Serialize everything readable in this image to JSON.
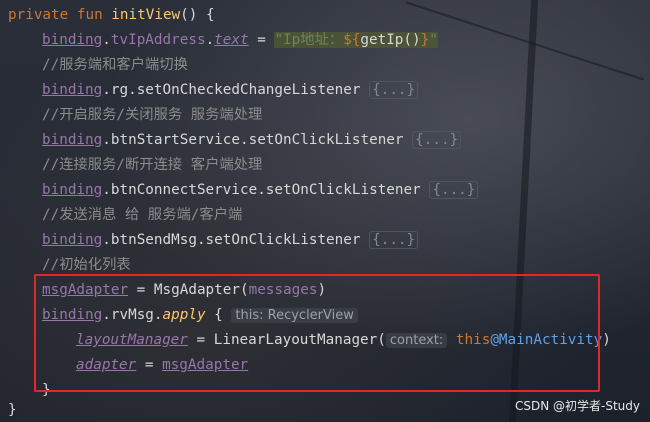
{
  "code": {
    "l1": {
      "kw": "private fun ",
      "fn": "initView",
      "rest": "() {"
    },
    "l2": {
      "recv": "binding",
      "dot1": ".",
      "p1": "tvIpAddress",
      "dot2": ".",
      "p2": "text",
      "eq": " = ",
      "s1": "\"Ip地址：",
      "tmpl": "${",
      "call": "getIp()",
      "tmplEnd": "}",
      "s2": "\""
    },
    "l3": {
      "comment": "//服务端和客户端切换"
    },
    "l4": {
      "recv": "binding",
      "mid": ".rg.setOnCheckedChangeListener ",
      "fold": "{...}"
    },
    "l5": {
      "comment": "//开启服务/关闭服务 服务端处理"
    },
    "l6": {
      "recv": "binding",
      "mid": ".btnStartService.setOnClickListener ",
      "fold": "{...}"
    },
    "l7": {
      "comment": "//连接服务/断开连接 客户端处理"
    },
    "l8": {
      "recv": "binding",
      "mid": ".btnConnectService.setOnClickListener ",
      "fold": "{...}"
    },
    "l9": {
      "comment": "//发送消息 给 服务端/客户端"
    },
    "l10": {
      "recv": "binding",
      "mid": ".btnSendMsg.setOnClickListener ",
      "fold": "{...}"
    },
    "l11": {
      "comment": "//初始化列表"
    },
    "l12": {
      "var": "msgAdapter",
      "eq": " = ",
      "ctor": "MsgAdapter(",
      "arg": "messages",
      "close": ")"
    },
    "l13": {
      "recv": "binding",
      "mid": ".rvMsg.",
      "apply": "apply",
      "brace": " {",
      "hint": "this: RecyclerView"
    },
    "l14": {
      "prop": "layoutManager",
      "eq": " = ",
      "ctor": "LinearLayoutManager(",
      "hint": "context:",
      "thisKw": "this",
      "label": "@MainActivity",
      "close": ")"
    },
    "l15": {
      "prop": "adapter",
      "eq": " = ",
      "val": "msgAdapter"
    },
    "l16": {
      "brace": "}"
    },
    "l17": {
      "brace": "}"
    }
  },
  "watermark": "CSDN @初学者-Study",
  "colors": {
    "highlight_box": "#e02828",
    "keyword": "#cc7832",
    "function": "#ffc66d",
    "property": "#9876aa",
    "comment": "#8c8c8c",
    "string": "#6a8759"
  }
}
